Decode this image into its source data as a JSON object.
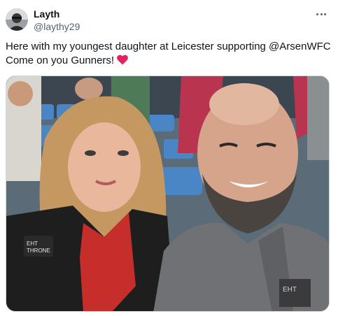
{
  "author": {
    "display_name": "Layth",
    "handle": "@laythy29"
  },
  "tweet": {
    "text_before_mention": "Here with my youngest daughter at Leicester supporting ",
    "mention": "@ArsenWFC",
    "text_line2": "Come on you Gunners!",
    "heart_emoji_icon": "red-heart-icon"
  },
  "photo": {
    "description_icon": "selfie-photo",
    "jacket_logo_text": "EHT THRONE"
  },
  "colors": {
    "text": "#0f1419",
    "secondary": "#536471",
    "heart": "#e0245e"
  }
}
